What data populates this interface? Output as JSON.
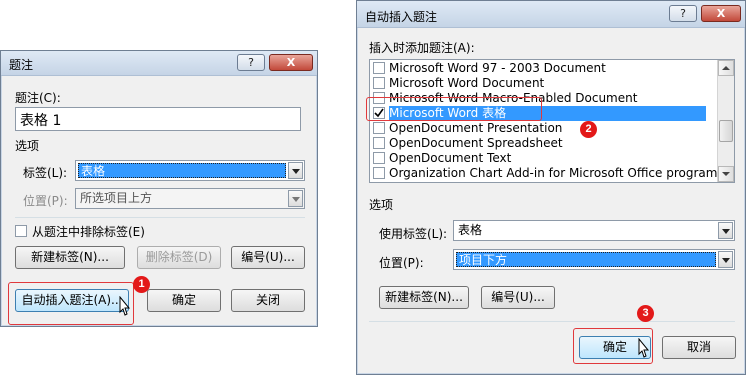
{
  "left_dialog": {
    "title": "题注",
    "help_btn": "?",
    "close_btn": "X",
    "caption_label": "题注(C):",
    "caption_value": "表格 1",
    "options_label": "选项",
    "tag_label": "标签(L):",
    "tag_value": "表格",
    "position_label": "位置(P):",
    "position_value": "所选项目上方",
    "exclude_checkbox": "从题注中排除标签(E)",
    "new_tag_btn": "新建标签(N)...",
    "delete_tag_btn": "删除标签(D)",
    "numbering_btn": "编号(U)...",
    "auto_insert_btn": "自动插入题注(A)...",
    "ok_btn": "确定",
    "close_action_btn": "关闭",
    "marker": "1"
  },
  "right_dialog": {
    "title": "自动插入题注",
    "help_btn": "?",
    "close_btn": "X",
    "list_label": "插入时添加题注(A):",
    "items": [
      {
        "label": "Microsoft Word 97 - 2003 Document",
        "checked": false
      },
      {
        "label": "Microsoft Word Document",
        "checked": false
      },
      {
        "label": "Microsoft Word Macro-Enabled Document",
        "checked": false
      },
      {
        "label": "Microsoft Word 表格",
        "checked": true
      },
      {
        "label": "OpenDocument Presentation",
        "checked": false
      },
      {
        "label": "OpenDocument Spreadsheet",
        "checked": false
      },
      {
        "label": "OpenDocument Text",
        "checked": false
      },
      {
        "label": "Organization Chart Add-in for Microsoft Office program",
        "checked": false
      }
    ],
    "options_label": "选项",
    "use_tag_label": "使用标签(L):",
    "use_tag_value": "表格",
    "position_label": "位置(P):",
    "position_value": "项目下方",
    "new_tag_btn": "新建标签(N)...",
    "numbering_btn": "编号(U)...",
    "ok_btn": "确定",
    "cancel_btn": "取消",
    "marker_2": "2",
    "marker_3": "3"
  },
  "colors": {
    "accent": "#3399ff",
    "marker": "#e31919",
    "dialog_bg": "#f0f0f0"
  }
}
